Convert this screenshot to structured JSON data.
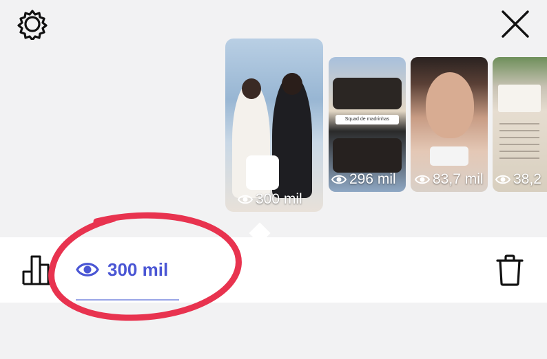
{
  "header": {
    "settings_icon": "gear-icon",
    "close_icon": "close-icon"
  },
  "stories": [
    {
      "views": "300 mil",
      "selected": true,
      "icon": "eye-icon"
    },
    {
      "views": "296 mil",
      "selected": false,
      "icon": "eye-icon",
      "caption": "Squad de madrinhas"
    },
    {
      "views": "83,7 mil",
      "selected": false,
      "icon": "eye-icon"
    },
    {
      "views": "38,2",
      "selected": false,
      "icon": "eye-icon"
    }
  ],
  "actions": {
    "stats_icon": "bar-chart-icon",
    "views_label": "300 mil",
    "views_icon": "eye-icon",
    "delete_icon": "trash-icon"
  },
  "colors": {
    "accent": "#4a56d4",
    "annotation": "#e8334f",
    "background": "#f2f2f3"
  }
}
